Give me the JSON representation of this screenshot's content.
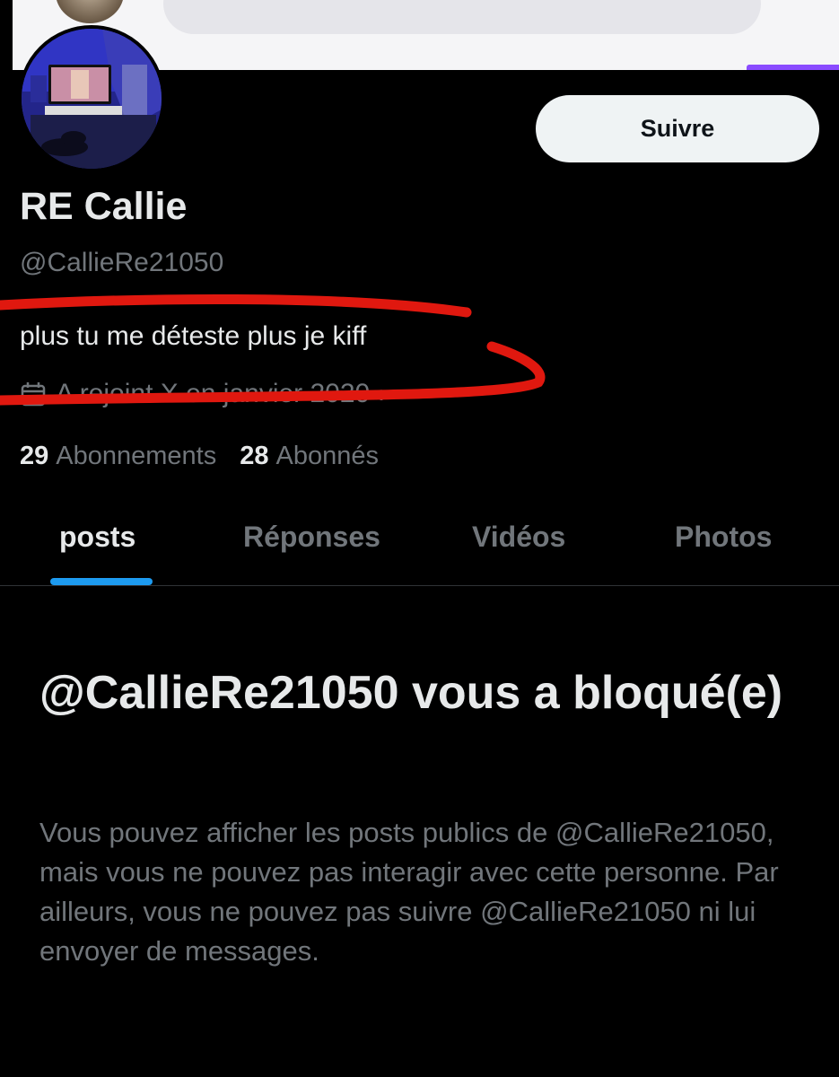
{
  "profile": {
    "display_name": "RE Callie",
    "handle": "@CallieRe21050",
    "bio": "plus tu me déteste plus je kiff",
    "joined": "A rejoint X en janvier 2020",
    "follow_label": "Suivre",
    "avatar_icon": "avatar-photo"
  },
  "stats": {
    "following_count": "29",
    "following_label": "Abonnements",
    "followers_count": "28",
    "followers_label": "Abonnés"
  },
  "tabs": [
    {
      "label": "posts",
      "active": true
    },
    {
      "label": "Réponses",
      "active": false
    },
    {
      "label": "Vidéos",
      "active": false
    },
    {
      "label": "Photos",
      "active": false
    }
  ],
  "blocked": {
    "title": "@CallieRe21050 vous a bloqué(e)",
    "message": "Vous pouvez afficher les posts publics de @CallieRe21050, mais vous ne pouvez pas interagir avec cette personne. Par ailleurs, vous ne pouvez pas suivre @CallieRe21050 ni lui envoyer de messages."
  },
  "colors": {
    "background": "#000000",
    "accent": "#1d9bf0",
    "scribble": "#e0180f",
    "muted_text": "#71767b"
  }
}
